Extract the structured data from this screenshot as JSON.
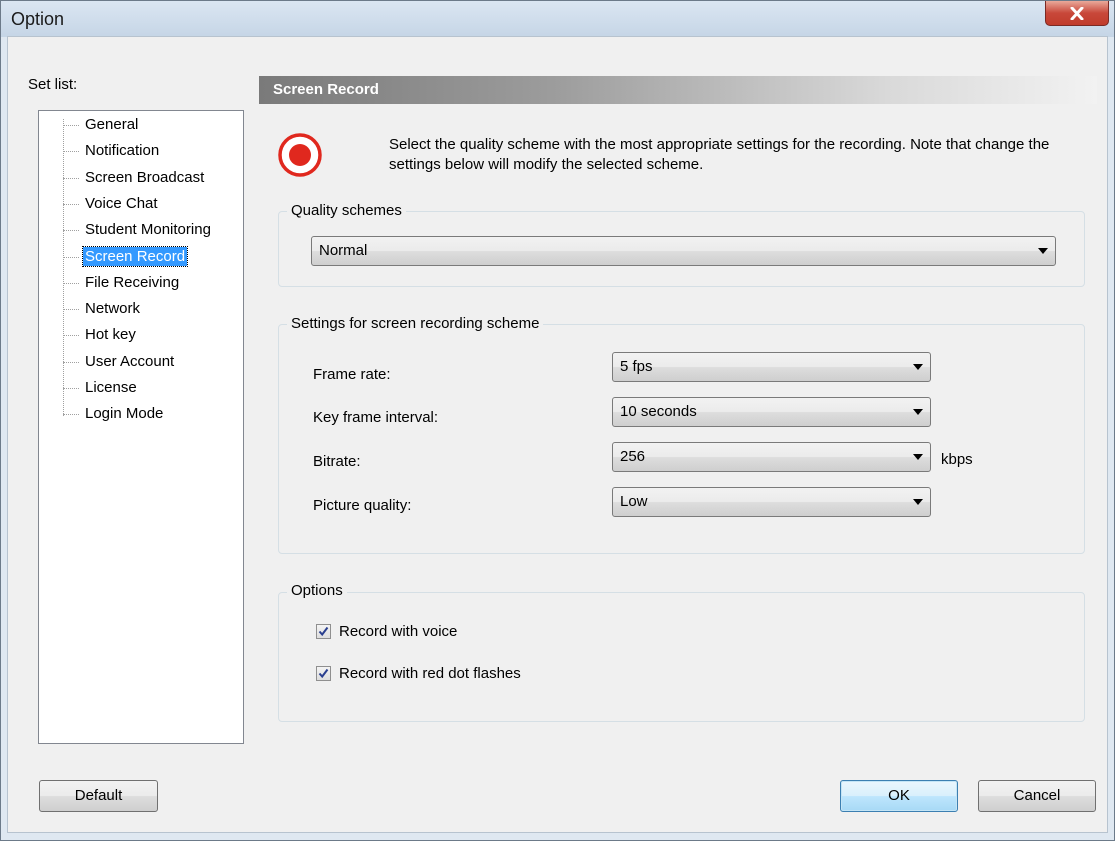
{
  "window": {
    "title": "Option"
  },
  "sidebar": {
    "label": "Set list:",
    "items": [
      {
        "label": "General",
        "selected": false
      },
      {
        "label": "Notification",
        "selected": false
      },
      {
        "label": "Screen Broadcast",
        "selected": false
      },
      {
        "label": "Voice Chat",
        "selected": false
      },
      {
        "label": "Student Monitoring",
        "selected": false
      },
      {
        "label": "Screen Record",
        "selected": true
      },
      {
        "label": "File Receiving",
        "selected": false
      },
      {
        "label": "Network",
        "selected": false
      },
      {
        "label": "Hot key",
        "selected": false
      },
      {
        "label": "User Account",
        "selected": false
      },
      {
        "label": "License",
        "selected": false
      },
      {
        "label": "Login Mode",
        "selected": false
      }
    ]
  },
  "main": {
    "header": "Screen Record",
    "description": "Select the quality scheme with the most appropriate settings for the recording. Note that change the settings below will modify the selected scheme.",
    "quality": {
      "title": "Quality schemes",
      "value": "Normal"
    },
    "settings": {
      "title": "Settings for screen recording scheme",
      "frame_rate": {
        "label": "Frame rate:",
        "value": "5 fps"
      },
      "key_frame": {
        "label": "Key frame interval:",
        "value": "10 seconds"
      },
      "bitrate": {
        "label": "Bitrate:",
        "value": "256",
        "unit": "kbps"
      },
      "picture_quality": {
        "label": "Picture quality:",
        "value": "Low"
      }
    },
    "options": {
      "title": "Options",
      "record_voice": {
        "label": "Record with voice",
        "checked": true
      },
      "red_dot": {
        "label": "Record with red dot flashes",
        "checked": true
      }
    }
  },
  "footer": {
    "default_label": "Default",
    "ok_label": "OK",
    "cancel_label": "Cancel"
  },
  "colors": {
    "record_red": "#e0281e",
    "selection": "#3399ff",
    "close_red": "#c8483a"
  }
}
